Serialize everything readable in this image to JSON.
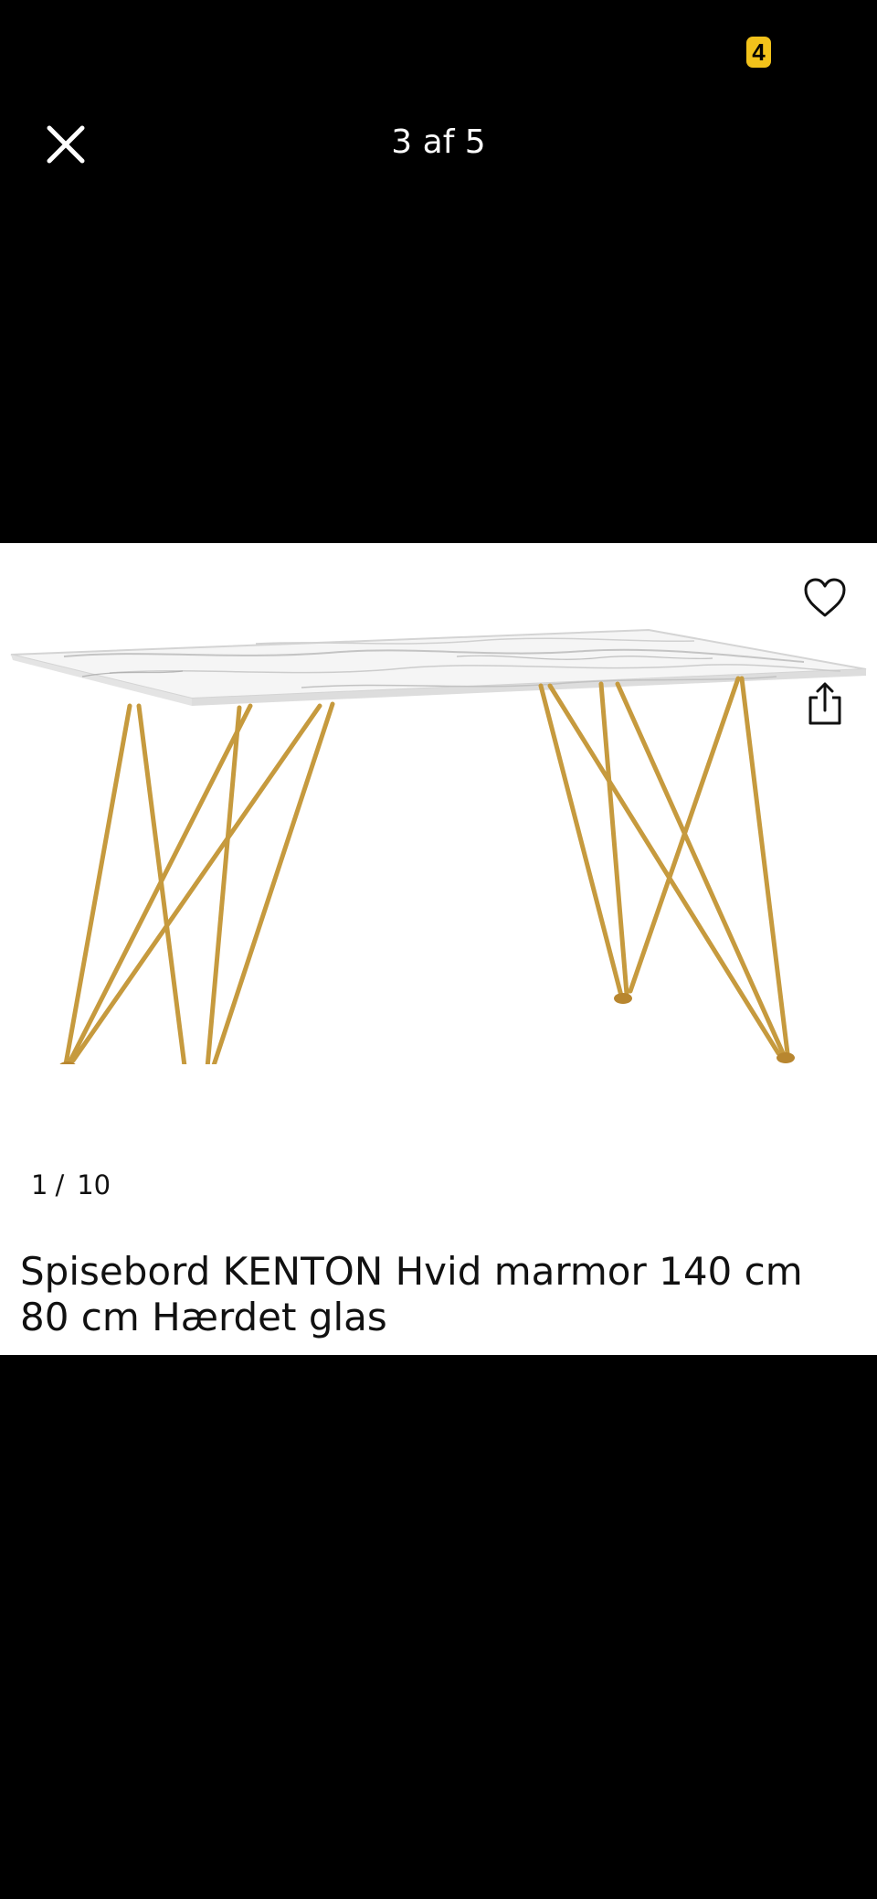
{
  "status_bar": {
    "badge_text": "4",
    "badge_color": "#f2c21b"
  },
  "viewer": {
    "counter": "3 af 5",
    "close_icon": "close-icon"
  },
  "screenshot_card": {
    "actions": {
      "favorite_icon": "heart-icon",
      "share_icon": "share-icon"
    },
    "pager": {
      "current": "1",
      "separator": "/",
      "total": "10"
    },
    "title": "Spisebord KENTON Hvid marmor 140 cm 80 cm Hærdet glas"
  },
  "colors": {
    "background": "#000000",
    "card": "#ffffff",
    "table_legs": "#c69a3e",
    "text": "#111111"
  }
}
